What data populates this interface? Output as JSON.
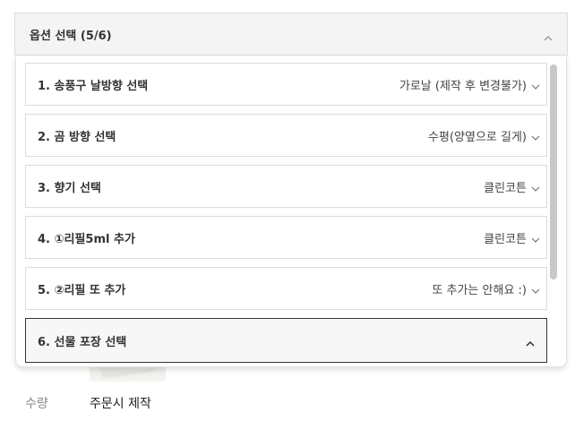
{
  "option_selector": {
    "title": "옵션 선택 (5/6)",
    "options": [
      {
        "label": "1. 송풍구 날방향 선택",
        "value": "가로날 (제작 후 변경불가)"
      },
      {
        "label": "2. 곰 방향 선택",
        "value": "수평(양옆으로 길게)"
      },
      {
        "label": "3. 향기 선택",
        "value": "클린코튼"
      },
      {
        "label": "4. ①리필5ml 추가",
        "value": "클린코튼"
      },
      {
        "label": "5. ②리필 또 추가",
        "value": "또 추가는 안해요 :)"
      }
    ],
    "active_option": {
      "label": "6. 선물 포장 선택"
    }
  },
  "quantity": {
    "label": "수량",
    "value": "주문시 제작"
  }
}
